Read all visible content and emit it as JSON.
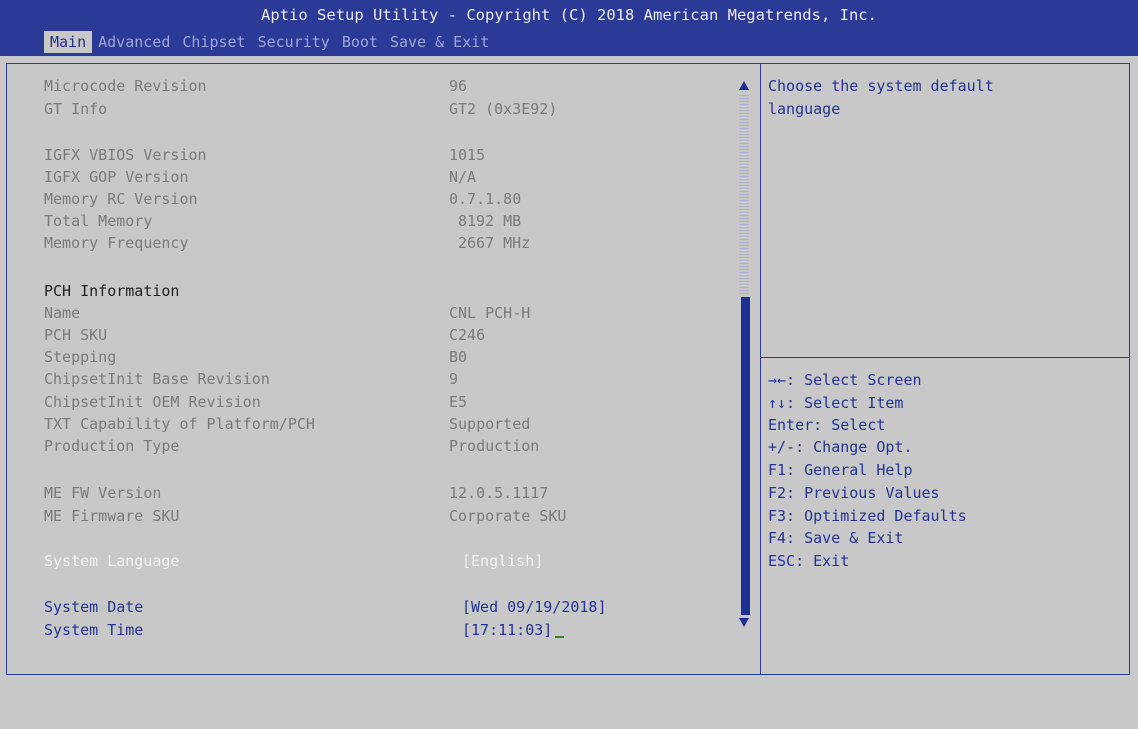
{
  "header": {
    "title": "Aptio Setup Utility - Copyright (C) 2018 American Megatrends, Inc.",
    "tabs": [
      "Main",
      "Advanced",
      "Chipset",
      "Security",
      "Boot",
      "Save & Exit"
    ],
    "active_tab": "Main"
  },
  "info": {
    "microcode_label": "Microcode Revision",
    "microcode_value": "96",
    "gtinfo_label": "GT Info",
    "gtinfo_value": "GT2 (0x3E92)",
    "igfx_vbios_label": "IGFX VBIOS Version",
    "igfx_vbios_value": "1015",
    "igfx_gop_label": "IGFX GOP Version",
    "igfx_gop_value": "N/A",
    "memrc_label": "Memory RC Version",
    "memrc_value": "0.7.1.80",
    "totalmem_label": "Total Memory",
    "totalmem_value": "8192 MB",
    "memfreq_label": "Memory Frequency",
    "memfreq_value": "2667 MHz",
    "pch_heading": "PCH Information",
    "name_label": "Name",
    "name_value": "CNL PCH-H",
    "pchsku_label": "PCH SKU",
    "pchsku_value": "C246",
    "stepping_label": "Stepping",
    "stepping_value": "B0",
    "cibase_label": "ChipsetInit Base Revision",
    "cibase_value": "9",
    "cioem_label": "ChipsetInit OEM Revision",
    "cioem_value": "E5",
    "txt_label": "TXT Capability of Platform/PCH",
    "txt_value": "Supported",
    "prodtype_label": "Production Type",
    "prodtype_value": "Production",
    "mefw_label": "ME FW Version",
    "mefw_value": "12.0.5.1117",
    "mesku_label": "ME Firmware SKU",
    "mesku_value": "Corporate SKU"
  },
  "settings": {
    "language_label": "System Language",
    "language_value": "[English]",
    "date_label": "System Date",
    "date_value": "[Wed 09/19/2018]",
    "time_label": "System Time",
    "time_value": "[17:11:03]"
  },
  "help": {
    "description_line1": "Choose the system default",
    "description_line2": "language",
    "keys": [
      "→←: Select Screen",
      "↑↓: Select Item",
      "Enter: Select",
      "+/-: Change Opt.",
      "F1: General Help",
      "F2: Previous Values",
      "F3: Optimized Defaults",
      "F4: Save & Exit",
      "ESC: Exit"
    ]
  },
  "colors": {
    "header_bg": "#2c3a97",
    "panel_bg": "#c8c8c8",
    "accent": "#233394",
    "selected_text": "#f2f2f2",
    "info_text": "#7a7a7a"
  }
}
